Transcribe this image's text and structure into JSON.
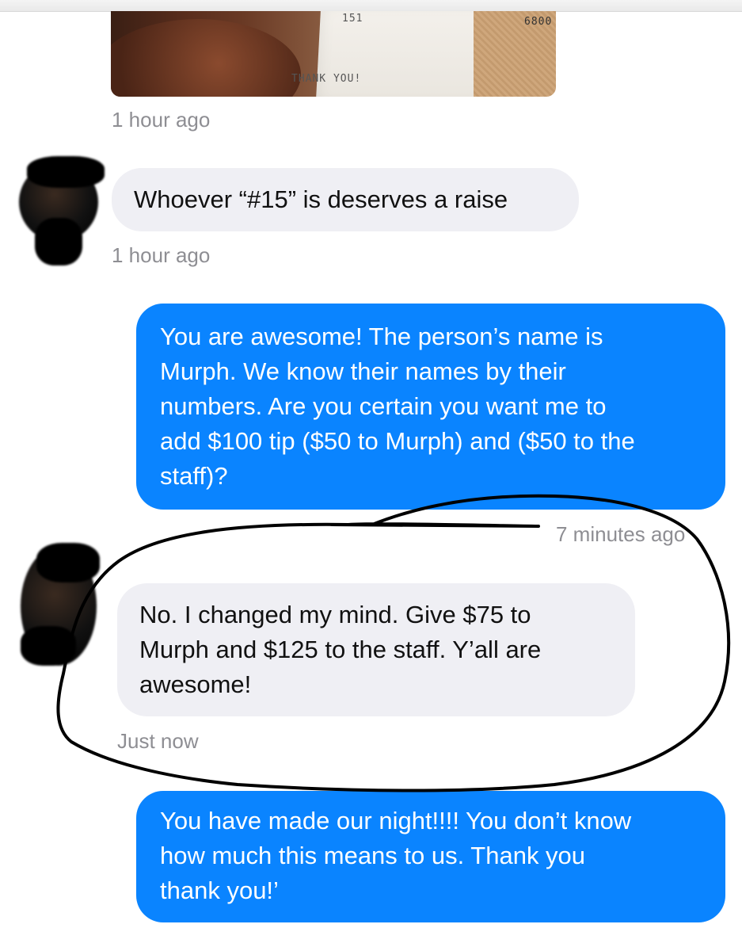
{
  "photo": {
    "receipt_number": "6800",
    "receipt_label": "151",
    "receipt_thanks": "THANK YOU!"
  },
  "messages": [
    {
      "side": "incoming",
      "type": "photo",
      "timestamp": "1 hour ago"
    },
    {
      "side": "incoming",
      "lines": [
        "Whoever “#15” is deserves a raise"
      ],
      "timestamp": "1 hour ago"
    },
    {
      "side": "outgoing",
      "lines": [
        "You are awesome!  The person’s name is",
        "Murph. We know their names by their",
        "numbers. Are you certain you want me to",
        "add $100 tip ($50 to Murph) and ($50 to the",
        "staff)?"
      ],
      "timestamp": "7 minutes ago ·"
    },
    {
      "side": "incoming",
      "lines": [
        "No. I changed my mind. Give $75 to",
        "Murph and $125 to the staff. Y’all are",
        "awesome!"
      ],
      "timestamp": "Just now"
    },
    {
      "side": "outgoing",
      "lines": [
        "You have made our night!!!!  You don’t know",
        "how much this means to us. Thank you",
        "thank you!’"
      ]
    }
  ],
  "colors": {
    "outgoing_bubble": "#0a84ff",
    "incoming_bubble": "#efeff4",
    "timestamp_text": "#8e8e93",
    "annotation_ink": "#000000"
  },
  "annotation": {
    "shape": "hand-drawn-circle",
    "highlights": "messages.3"
  }
}
